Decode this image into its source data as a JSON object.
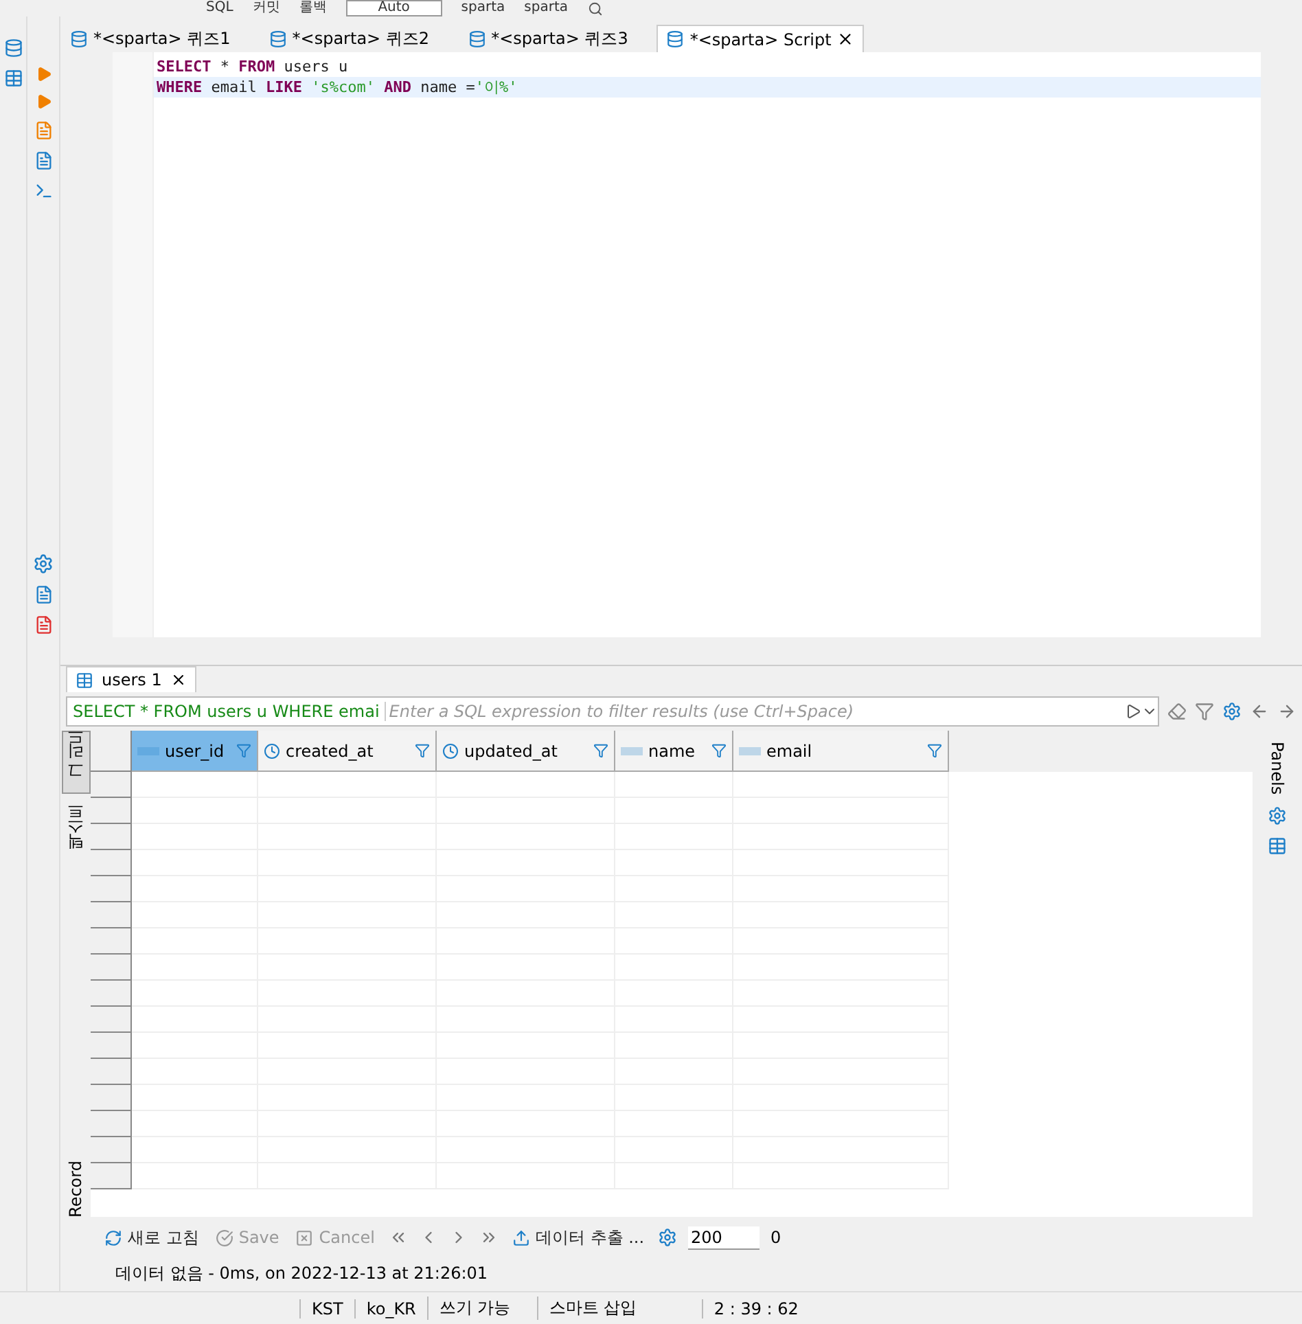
{
  "toolbar": {
    "buttons": [
      "SQL",
      "커밋",
      "롤백"
    ],
    "transaction_mode": "Auto",
    "datasource": "sparta",
    "schema": "sparta"
  },
  "editor_tabs": [
    {
      "label": "*<sparta> 퀴즈1",
      "selected": false
    },
    {
      "label": "*<sparta> 퀴즈2",
      "selected": false
    },
    {
      "label": "*<sparta> 퀴즈3",
      "selected": false
    },
    {
      "label": "*<sparta> Script",
      "selected": true
    }
  ],
  "editor": {
    "lines": [
      {
        "current": false,
        "tokens": [
          {
            "kind": "keyword",
            "text": "SELECT"
          },
          {
            "kind": "plain",
            "text": " * "
          },
          {
            "kind": "keyword",
            "text": "FROM"
          },
          {
            "kind": "plain",
            "text": " users u"
          }
        ]
      },
      {
        "current": true,
        "tokens": [
          {
            "kind": "keyword",
            "text": "WHERE"
          },
          {
            "kind": "plain",
            "text": " email "
          },
          {
            "kind": "keyword",
            "text": "LIKE"
          },
          {
            "kind": "string",
            "text": " 's%com' "
          },
          {
            "kind": "keyword",
            "text": "AND"
          },
          {
            "kind": "plain",
            "text": " name ="
          },
          {
            "kind": "string",
            "text": "'이%'"
          }
        ]
      }
    ]
  },
  "results": {
    "tab": "users 1",
    "query": "SELECT * FROM users u WHERE emai",
    "filter_placeholder": "Enter a SQL expression to filter results (use Ctrl+Space)",
    "view_tabs": [
      {
        "label": "그리드",
        "selected": true
      },
      {
        "label": "텍스트",
        "selected": false
      }
    ],
    "record_label": "Record",
    "panels_label": "Panels",
    "columns": [
      {
        "name": "user_id",
        "kind": "text",
        "selected": true
      },
      {
        "name": "created_at",
        "kind": "date",
        "selected": false
      },
      {
        "name": "updated_at",
        "kind": "date",
        "selected": false
      },
      {
        "name": "name",
        "kind": "text",
        "selected": false
      },
      {
        "name": "email",
        "kind": "text",
        "selected": false
      }
    ],
    "toolbar": {
      "refresh": "새로 고침",
      "save": {
        "label": "Save",
        "disabled": true
      },
      "cancel": {
        "label": "Cancel",
        "disabled": true
      },
      "export": "데이터 추출 ...",
      "fetch_size": "200",
      "count": "0"
    },
    "status_message": "데이터 없음 - 0ms, on 2022-12-13 at 21:26:01"
  },
  "status_bar": [
    "KST",
    "ko_KR",
    "쓰기 가능",
    "스마트 삽입",
    "2 : 39 : 62"
  ]
}
